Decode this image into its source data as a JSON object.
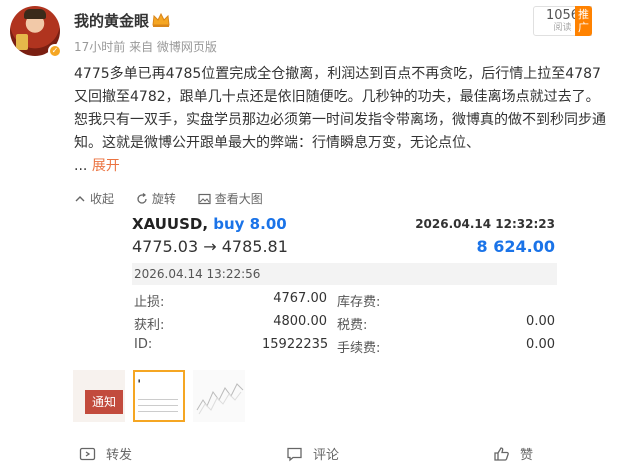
{
  "user": {
    "name": "我的黄金眼",
    "post_time": "17小时前",
    "source": "来自 微博网页版"
  },
  "read_count": {
    "number": "1056",
    "label": "阅读"
  },
  "push_label": "推广",
  "post": {
    "text": "4775多单已再4785位置完成全仓撤离，利润达到百点不再贪吃，后行情上拉至4787又回撤至4782，跟单几十点还是依旧随便吃。几秒钟的功夫，最佳离场点就过去了。恕我只有一双手，实盘学员那边必须第一时间发指令带离场，微博真的做不到秒同步通知。这就是微博公开跟单最大的弊端：行情瞬息万变，无论点位、",
    "ellipsis": "... ",
    "expand_label": "展开"
  },
  "tools": {
    "collapse": "收起",
    "rotate": "旋转",
    "view_large": "查看大图"
  },
  "trade": {
    "symbol": "XAUUSD,",
    "side": "buy 8.00",
    "open_time": "2026.04.14 12:32:23",
    "price_move": "4775.03 → 4785.81",
    "profit": "8 624.00",
    "close_time": "2026.04.14 13:22:56",
    "rows": [
      {
        "k1": "止损:",
        "v1": "4767.00",
        "k2": "库存费:",
        "v2": ""
      },
      {
        "k1": "获利:",
        "v1": "4800.00",
        "k2": "税费:",
        "v2": "0.00"
      },
      {
        "k1": "ID:",
        "v1": "15922235",
        "k2": "手续费:",
        "v2": "0.00"
      }
    ]
  },
  "thumbs": {
    "notice_label": "通知"
  },
  "actions": {
    "repost": "转发",
    "comment": "评论",
    "like": "赞"
  }
}
